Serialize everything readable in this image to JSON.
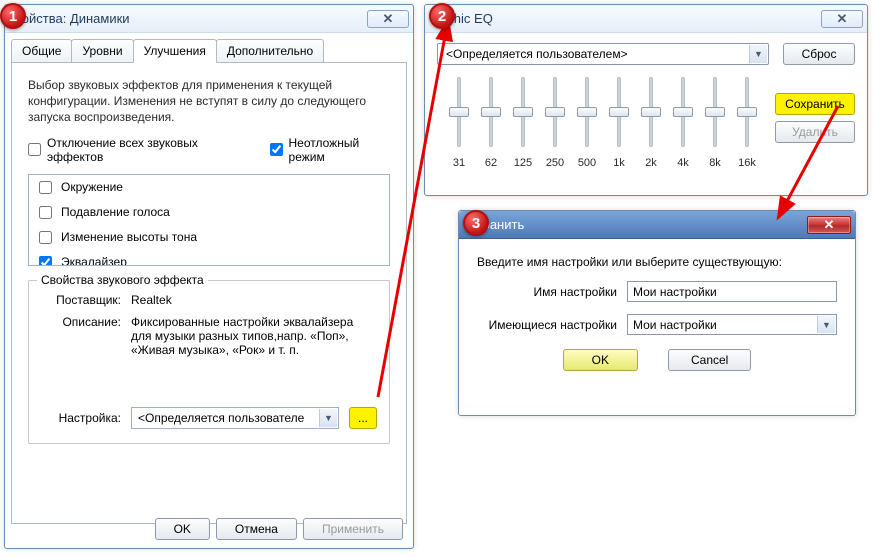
{
  "badges": {
    "one": "1",
    "two": "2",
    "three": "3"
  },
  "win1": {
    "title": "войства: Динамики",
    "tabs": [
      "Общие",
      "Уровни",
      "Улучшения",
      "Дополнительно"
    ],
    "description": "Выбор звуковых эффектов для применения к текущей конфигурации. Изменения не вступят в силу до следующего запуска воспроизведения.",
    "cb_disable_all": "Отключение всех звуковых эффектов",
    "cb_immediate": "Неотложный режим",
    "effects": [
      {
        "label": "Окружение",
        "checked": false
      },
      {
        "label": "Подавление голоса",
        "checked": false
      },
      {
        "label": "Изменение высоты тона",
        "checked": false
      },
      {
        "label": "Эквалайзер",
        "checked": true
      }
    ],
    "group_legend": "Свойства звукового эффекта",
    "vendor_k": "Поставщик:",
    "vendor_v": "Realtek",
    "desc_k": "Описание:",
    "desc_v": "Фиксированные настройки эквалайзера для музыки разных типов,напр. «Поп», «Живая музыка», «Рок» и т. п.",
    "setting_k": "Настройка:",
    "setting_v": "<Определяется пользователе",
    "ellipsis": "...",
    "ok": "OK",
    "cancel": "Отмена",
    "apply": "Применить"
  },
  "win2": {
    "title": "raphic EQ",
    "preset": "<Определяется пользователем>",
    "reset": "Сброс",
    "save": "Сохранить",
    "delete": "Удалить",
    "bands": [
      "31",
      "62",
      "125",
      "250",
      "500",
      "1k",
      "2k",
      "4k",
      "8k",
      "16k"
    ]
  },
  "win3": {
    "title": "охранить",
    "prompt": "Введите имя настройки или выберите существующую:",
    "name_label": "Имя настройки",
    "name_value": "Мои настройки",
    "existing_label": "Имеющиеся настройки",
    "existing_value": "Мои настройки",
    "ok": "OK",
    "cancel": "Cancel"
  }
}
